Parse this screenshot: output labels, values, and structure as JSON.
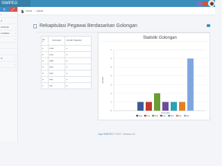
{
  "app": {
    "brand": "SIMPEG"
  },
  "topbar": {
    "icons": [
      "envelope-icon",
      "bell-icon",
      "user-avatar"
    ]
  },
  "sidebar": {
    "buttons": [
      "menu-icon",
      "share-icon"
    ],
    "items": [
      {
        "label": "t",
        "chevron": false
      },
      {
        "label": "si",
        "chevron": false
      },
      {
        "label": "awangan",
        "chevron": true
      },
      {
        "label": "endidikan",
        "chevron": true
      },
      {
        "label": "",
        "chevron": true
      },
      {
        "label": "",
        "chevron": false
      },
      {
        "label": "",
        "chevron": false
      },
      {
        "label": "at",
        "chevron": true
      },
      {
        "label": "",
        "chevron": true
      }
    ]
  },
  "breadcrumb": {
    "home": "Home",
    "separator": ">",
    "current": "Admin"
  },
  "page": {
    "title": "Rekapitulasi Pegawai Berdasarkan Golongan"
  },
  "table": {
    "headers": [
      "No",
      "Golongan",
      "Jumlah Pegawai"
    ],
    "sort_indicator": "▾",
    "rows": [
      [
        "1",
        "IV/B",
        "1"
      ],
      [
        "2",
        "IV/A",
        "1"
      ],
      [
        "3",
        "III/B",
        "2"
      ],
      [
        "4",
        "III/C",
        "1"
      ],
      [
        "5",
        "III/A",
        "1"
      ],
      [
        "6",
        "II/D",
        "1"
      ],
      [
        "7",
        "II/A",
        "6"
      ]
    ]
  },
  "chart_data": {
    "type": "bar",
    "title": "Statistik Golongan",
    "xlabel": "Golongan",
    "ylabel": "Jumlah",
    "ylim": [
      0,
      7
    ],
    "yticks": [
      0,
      1,
      2,
      3,
      4,
      5,
      6,
      7
    ],
    "categories": [
      "Golongan"
    ],
    "legend_position": "bottom",
    "grid": true,
    "series": [
      {
        "name": "IV/B",
        "values": [
          1
        ],
        "color": "#3c5a99"
      },
      {
        "name": "IV/A",
        "values": [
          1
        ],
        "color": "#c0392b"
      },
      {
        "name": "III/B",
        "values": [
          2
        ],
        "color": "#6b9e32"
      },
      {
        "name": "III/C",
        "values": [
          1
        ],
        "color": "#6c4e9b"
      },
      {
        "name": "III/A",
        "values": [
          1
        ],
        "color": "#2aa1b5"
      },
      {
        "name": "II/D",
        "values": [
          1
        ],
        "color": "#e67e22"
      },
      {
        "name": "II/A",
        "values": [
          6
        ],
        "color": "#7ea7e0"
      }
    ]
  },
  "footer": {
    "brand_link": "Aspi SIMPEG",
    "text": "© 2017. Version 4.0"
  }
}
